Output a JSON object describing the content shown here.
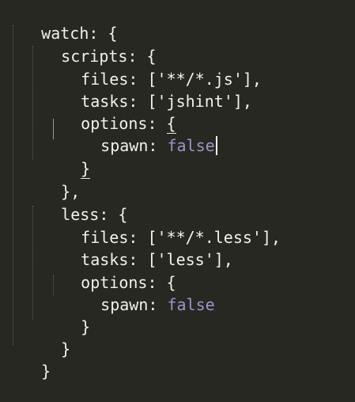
{
  "editor": {
    "language": "javascript",
    "colors": {
      "background": "#272822",
      "text": "#f1f1ea",
      "boolean": "#9c94c9",
      "indent_guide": "#5f5f55"
    },
    "lines": [
      {
        "indent": 0,
        "text": "watch: {"
      },
      {
        "indent": 1,
        "text": "scripts: {"
      },
      {
        "indent": 2,
        "text": "files: ['**/*.js'],"
      },
      {
        "indent": 2,
        "text": "tasks: ['jshint'],"
      },
      {
        "indent": 2,
        "prefix": "options: ",
        "brace": "{"
      },
      {
        "indent": 3,
        "key": "spawn: ",
        "value": "false",
        "cursor": true
      },
      {
        "indent": 2,
        "brace": "}"
      },
      {
        "indent": 1,
        "text": "},"
      },
      {
        "indent": 1,
        "text": "less: {"
      },
      {
        "indent": 2,
        "text": "files: ['**/*.less'],"
      },
      {
        "indent": 2,
        "text": "tasks: ['less'],"
      },
      {
        "indent": 2,
        "text": "options: {"
      },
      {
        "indent": 3,
        "key": "spawn: ",
        "value": "false"
      },
      {
        "indent": 2,
        "text": "}"
      },
      {
        "indent": 1,
        "text": "}"
      },
      {
        "indent": 0,
        "text": "}"
      }
    ]
  }
}
